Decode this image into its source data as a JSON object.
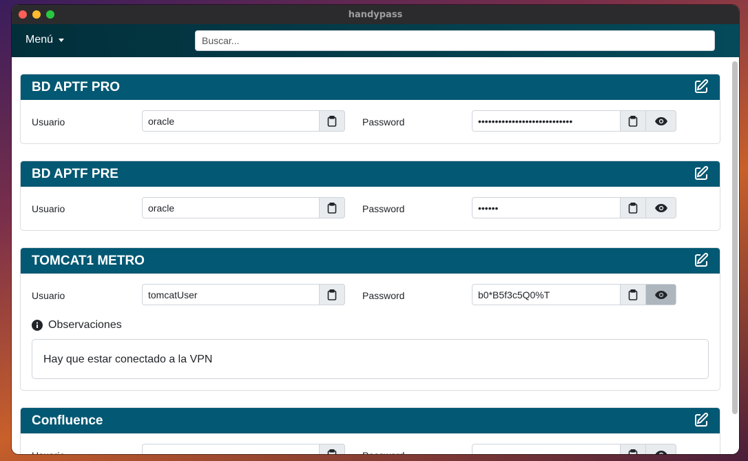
{
  "window": {
    "title": "handypass"
  },
  "navbar": {
    "menu_label": "Menú",
    "search_placeholder": "Buscar..."
  },
  "labels": {
    "user": "Usuario",
    "password": "Password",
    "observations": "Observaciones"
  },
  "icons": {
    "edit": "edit-icon",
    "copy": "clipboard-icon",
    "show": "eye-icon",
    "info": "info-circle-icon"
  },
  "colors": {
    "header": "#035873",
    "navbar": "#022f3a"
  },
  "cards": [
    {
      "title": "BD APTF PRO",
      "user": "oracle",
      "password": "••••••••••••••••••••••••••••",
      "observations": ""
    },
    {
      "title": "BD APTF PRE",
      "user": "oracle",
      "password": "••••••",
      "observations": ""
    },
    {
      "title": "TOMCAT1 METRO",
      "user": "tomcatUser",
      "password": "b0*B5f3c5Q0%T",
      "observations": "Hay que estar conectado a la VPN"
    },
    {
      "title": "Confluence",
      "user": "",
      "password": "",
      "observations": ""
    }
  ]
}
